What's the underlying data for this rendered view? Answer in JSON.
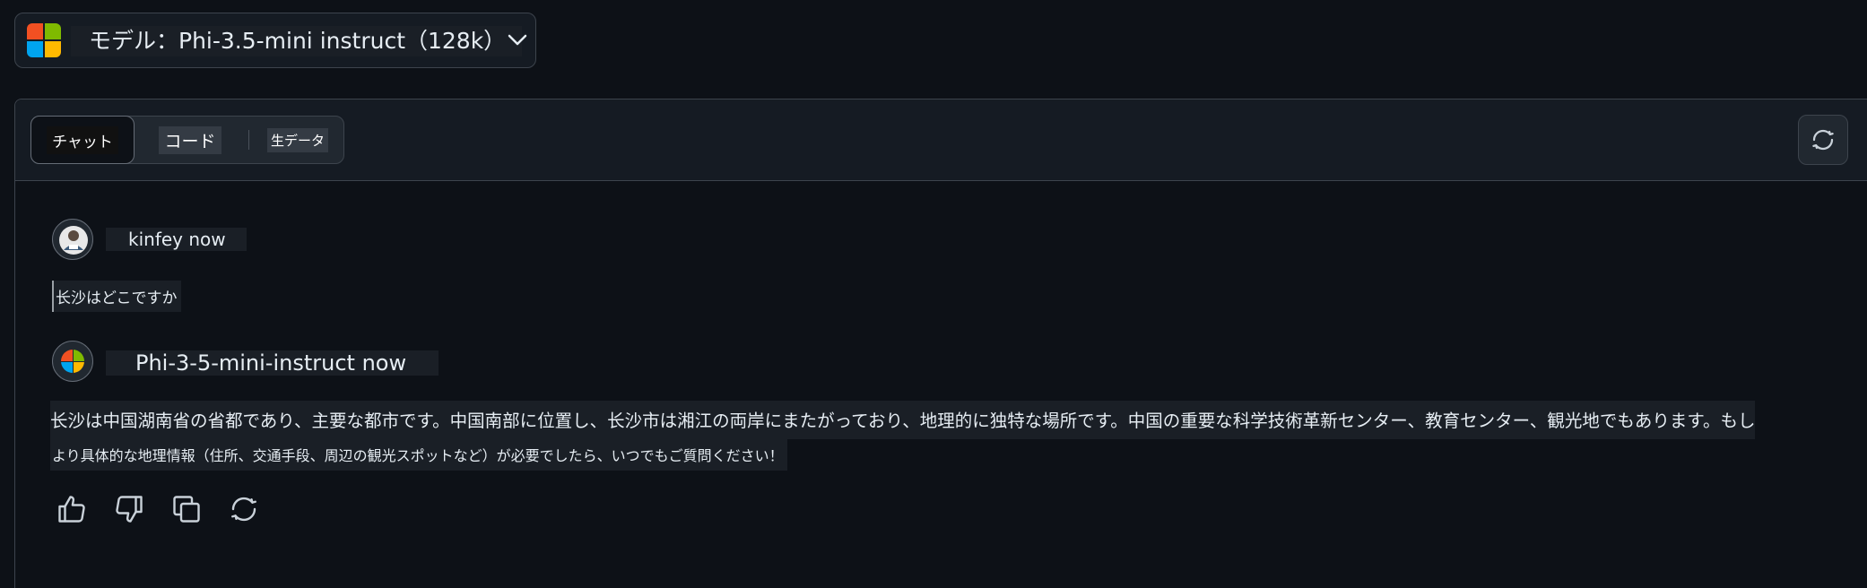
{
  "model_picker": {
    "label": "モデル：Phi-3.5-mini instruct（128k）",
    "logo_colors": [
      "#f25022",
      "#7fba00",
      "#00a4ef",
      "#ffb900"
    ]
  },
  "tabs": [
    {
      "label": "チャット"
    },
    {
      "label": "コード"
    },
    {
      "label": "生データ"
    }
  ],
  "conversation": {
    "user": {
      "name": "kinfey now",
      "message": "长沙はどこですか"
    },
    "assistant": {
      "name": "Phi-3-5-mini-instruct now",
      "message_line1": "长沙は中国湖南省の省都であり、主要な都市です。中国南部に位置し、长沙市は湘江の両岸にまたがっており、地理的に独特な場所です。中国の重要な科学技術革新センター、教育センター、観光地でもあります。もし",
      "message_line2": "より具体的な地理情報（住所、交通手段、周辺の観光スポットなど）が必要でしたら、いつでもご質問ください！"
    }
  },
  "actions": [
    "thumbs-up",
    "thumbs-down",
    "copy",
    "regenerate"
  ]
}
